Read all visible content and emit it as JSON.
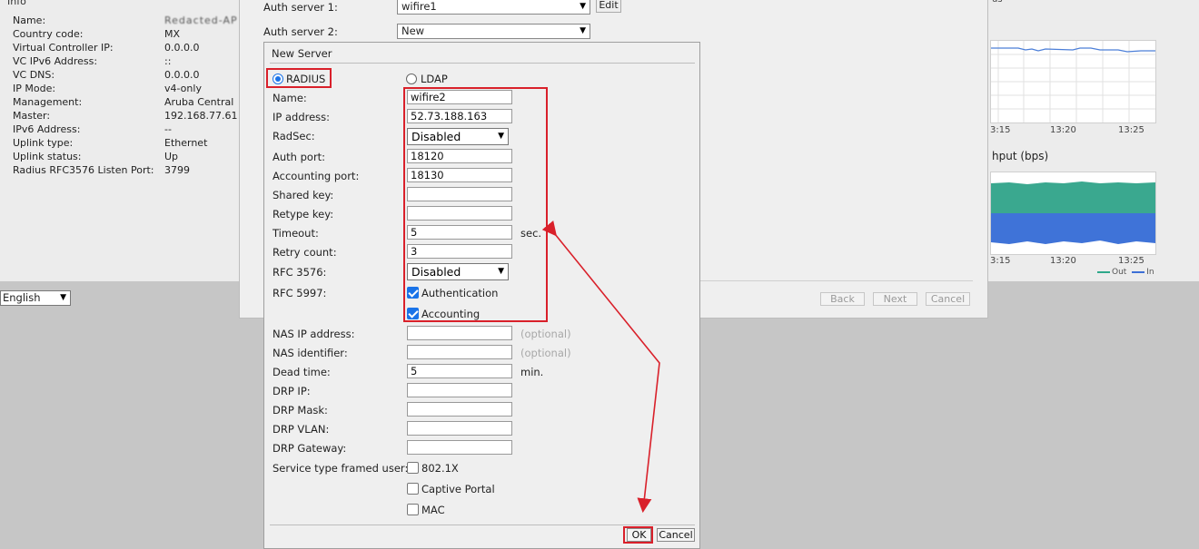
{
  "info": {
    "title": "Info",
    "rows": [
      {
        "label": "Name:",
        "value": "Redacted-AP"
      },
      {
        "label": "Country code:",
        "value": "MX"
      },
      {
        "label": "Virtual Controller IP:",
        "value": "0.0.0.0"
      },
      {
        "label": "VC IPv6 Address:",
        "value": "::"
      },
      {
        "label": "VC DNS:",
        "value": "0.0.0.0"
      },
      {
        "label": "IP Mode:",
        "value": "v4-only"
      },
      {
        "label": "Management:",
        "value": "Aruba Central"
      },
      {
        "label": "Master:",
        "value": "192.168.77.61"
      },
      {
        "label": "IPv6 Address:",
        "value": "--"
      },
      {
        "label": "Uplink type:",
        "value": "Ethernet"
      },
      {
        "label": "Uplink status:",
        "value": "Up"
      },
      {
        "label": "Radius RFC3576 Listen Port:",
        "value": "3799"
      }
    ]
  },
  "language": {
    "selected": "English"
  },
  "right_panel": {
    "title": "us",
    "chart1_ticks": [
      "3:15",
      "13:20",
      "13:25"
    ],
    "chart2_title": "hput  (bps)",
    "chart2_ticks": [
      "3:15",
      "13:20",
      "13:25"
    ],
    "legend": [
      {
        "label": "Out",
        "color": "#2ea88a"
      },
      {
        "label": "In",
        "color": "#3d6fd6"
      }
    ],
    "colors": {
      "out_fill": "#3aa88f",
      "in_fill": "#3f73d8",
      "line": "#4c7fd8"
    }
  },
  "wizard": {
    "auth1_label": "Auth server 1:",
    "auth1_value": "wifire1",
    "edit_label": "Edit",
    "auth2_label": "Auth server 2:",
    "auth2_value": "New",
    "back_label": "Back",
    "next_label": "Next",
    "cancel_label": "Cancel"
  },
  "dialog": {
    "title": "New Server",
    "radius_label": "RADIUS",
    "ldap_label": "LDAP",
    "server_type_selected": "RADIUS",
    "fields": {
      "name": {
        "label": "Name:",
        "value": "wifire2"
      },
      "ip": {
        "label": "IP address:",
        "value": "52.73.188.163"
      },
      "radsec": {
        "label": "RadSec:",
        "value": "Disabled"
      },
      "auth_port": {
        "label": "Auth port:",
        "value": "18120"
      },
      "acct_port": {
        "label": "Accounting port:",
        "value": "18130"
      },
      "shared_key": {
        "label": "Shared key:",
        "value": ""
      },
      "retype_key": {
        "label": "Retype key:",
        "value": ""
      },
      "timeout": {
        "label": "Timeout:",
        "value": "5",
        "suffix": "sec."
      },
      "retry": {
        "label": "Retry count:",
        "value": "3"
      },
      "rfc3576": {
        "label": "RFC 3576:",
        "value": "Disabled"
      },
      "rfc5997": {
        "label": "RFC 5997:",
        "auth_label": "Authentication",
        "acct_label": "Accounting",
        "auth_checked": true,
        "acct_checked": true
      },
      "nas_ip": {
        "label": "NAS IP address:",
        "value": "",
        "hint": "(optional)"
      },
      "nas_id": {
        "label": "NAS identifier:",
        "value": "",
        "hint": "(optional)"
      },
      "dead_time": {
        "label": "Dead time:",
        "value": "5",
        "suffix": "min."
      },
      "drp_ip": {
        "label": "DRP IP:",
        "value": ""
      },
      "drp_mask": {
        "label": "DRP Mask:",
        "value": ""
      },
      "drp_vlan": {
        "label": "DRP VLAN:",
        "value": ""
      },
      "drp_gateway": {
        "label": "DRP Gateway:",
        "value": ""
      },
      "service_type": {
        "label": "Service type framed user:",
        "opt1": "802.1X",
        "opt2": "Captive Portal",
        "opt3": "MAC",
        "checked1": false,
        "checked2": false,
        "checked3": false
      }
    },
    "ok_label": "OK",
    "cancel_label": "Cancel"
  },
  "annotation_color": "#d9202a"
}
